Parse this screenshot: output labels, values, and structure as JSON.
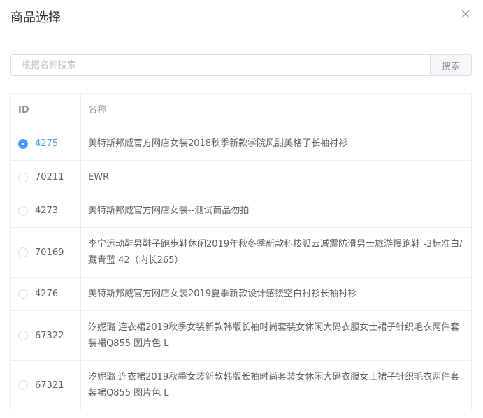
{
  "dialog": {
    "title": "商品选择"
  },
  "search": {
    "placeholder": "根据名称搜索",
    "value": "",
    "button_label": "搜索"
  },
  "table": {
    "headers": {
      "id": "ID",
      "name": "名称"
    },
    "rows": [
      {
        "id": "4275",
        "name": "美特斯邦威官方网店女装2018秋季新款学院风甜美格子长袖衬衫",
        "selected": true
      },
      {
        "id": "70211",
        "name": "EWR",
        "selected": false
      },
      {
        "id": "4273",
        "name": "美特斯邦威官方网店女装--测试商品勿拍",
        "selected": false
      },
      {
        "id": "70169",
        "name": "李宁运动鞋男鞋子跑步鞋休闲2019年秋冬季新款科技弧云减震防滑男士旅游慢跑鞋 -3标准白/藏青蓝 42（内长265）",
        "selected": false
      },
      {
        "id": "4276",
        "name": "美特斯邦威官方网店女装2019夏季新款设计感镂空白衬衫长袖衬衫",
        "selected": false
      },
      {
        "id": "67322",
        "name": "汐妮璐 连衣裙2019秋季女装新款韩版长袖时尚套装女休闲大码衣服女士裙子针织毛衣两件套装裙Q855 图片色 L",
        "selected": false
      },
      {
        "id": "67321",
        "name": "汐妮璐 连衣裙2019秋季女装新款韩版长袖时尚套装女休闲大码衣服女士裙子针织毛衣两件套装裙Q855 图片色 L",
        "selected": false
      }
    ]
  },
  "colors": {
    "accent": "#409eff",
    "border": "#ebeef5",
    "text": "#606266",
    "header_text": "#909399"
  },
  "icons": {
    "close": "close-icon",
    "radio": "radio-icon"
  }
}
